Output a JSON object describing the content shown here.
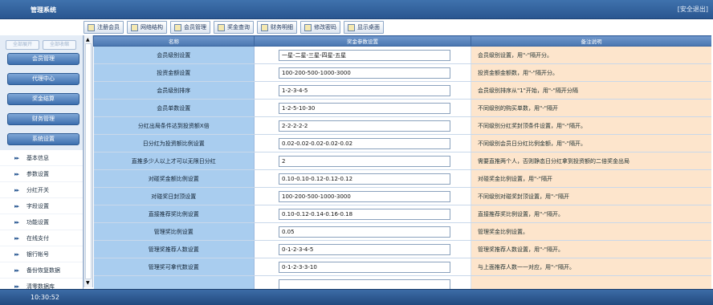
{
  "app": {
    "title": "管理系统",
    "logout": "[安全退出]"
  },
  "toolbar": [
    {
      "label": "注册会员",
      "icon": "register-icon"
    },
    {
      "label": "网络结构",
      "icon": "network-icon"
    },
    {
      "label": "会员管理",
      "icon": "members-icon"
    },
    {
      "label": "奖金查询",
      "icon": "bonus-icon"
    },
    {
      "label": "财务明细",
      "icon": "finance-icon"
    },
    {
      "label": "修改密码",
      "icon": "password-icon"
    },
    {
      "label": "显示桌面",
      "icon": "desktop-icon"
    }
  ],
  "sidebar": {
    "tabs": [
      "全部展开",
      "全部收缩"
    ],
    "sections": [
      "会员管理",
      "代理中心",
      "奖金结算",
      "财务管理",
      "系统设置"
    ],
    "items": [
      "基本信息",
      "参数设置",
      "分红开关",
      "字段设置",
      "功能设置",
      "在线支付",
      "银行帐号",
      "备份恢复数据",
      "清零数据库"
    ]
  },
  "table": {
    "headers": [
      "名称",
      "奖金参数设置",
      "备注说明"
    ],
    "rows": [
      {
        "name": "会员级别设置",
        "value": "一星-二星-三星-四星-五星",
        "note": "会员级别设置，用\"-\"隔开分。"
      },
      {
        "name": "投资金额设置",
        "value": "100-200-500-1000-3000",
        "note": "投资金额金额数，用\"-\"隔开分。"
      },
      {
        "name": "会员级别排序",
        "value": "1-2-3-4-5",
        "note": "会员级别排序从\"1\"开始，用\"-\"隔开分隔"
      },
      {
        "name": "会员单数设置",
        "value": "1-2-5-10-30",
        "note": "不同级别的购买单数，用\"-\"隔开"
      },
      {
        "name": "分红出局条件达到投资额X倍",
        "value": "2-2-2-2-2",
        "note": "不同级别分红奖封顶条件设置，用\"-\"隔开。"
      },
      {
        "name": "日分红为投资额比例设置",
        "value": "0.02-0.02-0.02-0.02-0.02",
        "note": "不同级别会员日分红比例金额，用\"-\"隔开。"
      },
      {
        "name": "直推多少人以上才可以无限日分红",
        "value": "2",
        "note": "需要直推两个人，否则静态日分红拿到投资额的二倍奖金出局"
      },
      {
        "name": "对碰奖金额比例设置",
        "value": "0.10-0.10-0.12-0.12-0.12",
        "note": "对碰奖金比例设置，用\"-\"隔开"
      },
      {
        "name": "对碰奖日封顶设置",
        "value": "100-200-500-1000-3000",
        "note": "不同级别对碰奖封顶设置，用\"-\"隔开"
      },
      {
        "name": "直接推荐奖比例设置",
        "value": "0.10-0.12-0.14-0.16-0.18",
        "note": "直接推荐奖比例设置，用\"-\"隔开。"
      },
      {
        "name": "管理奖比例设置",
        "value": "0.05",
        "note": "管理奖金比例设置。"
      },
      {
        "name": "管理奖推荐人数设置",
        "value": "0-1-2-3-4-5",
        "note": "管理奖推荐人数设置，用\"-\"隔开。"
      },
      {
        "name": "管理奖可拿代数设置",
        "value": "0-1-2-3-3-10",
        "note": "与上面推荐人数一一对应，用\"-\"隔开。"
      },
      {
        "name": "",
        "value": "",
        "note": ""
      }
    ]
  },
  "footer": {
    "time": "10:30:52"
  }
}
